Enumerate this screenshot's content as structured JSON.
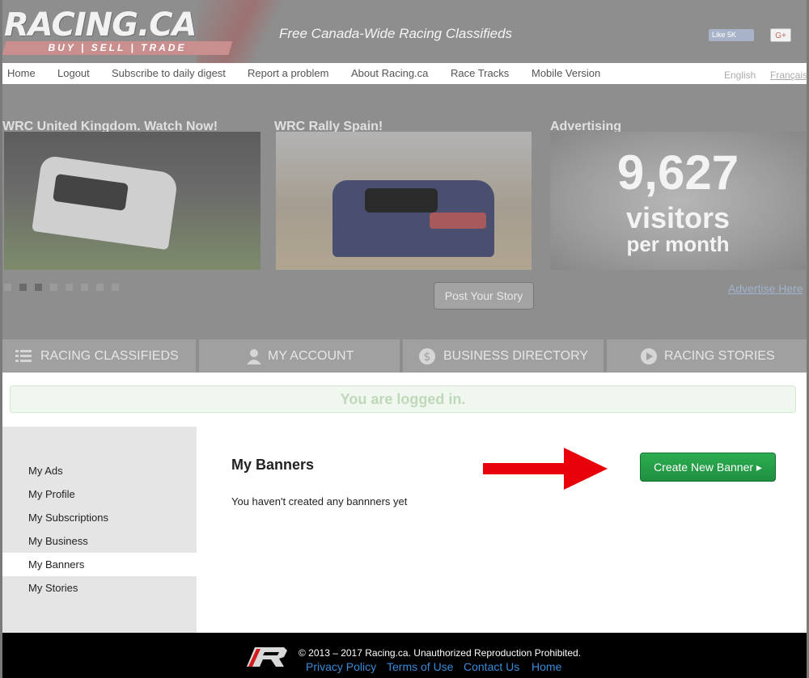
{
  "header": {
    "logo_word": "RACING.CA",
    "logo_tag": "BUY | SELL | TRADE",
    "tagline": "Free Canada-Wide Racing Classifieds",
    "fb_like": "Like 5K",
    "gplus": "G+"
  },
  "topnav": {
    "items": [
      "Home",
      "Logout",
      "Subscribe to daily digest",
      "Report a problem",
      "About Racing.ca",
      "Race Tracks",
      "Mobile Version"
    ],
    "lang_en": "English",
    "lang_fr": "Français"
  },
  "stories": {
    "story1_title": "WRC United Kingdom. Watch Now!",
    "story2_title": "WRC Rally Spain!",
    "ad_title": "Advertising",
    "ad_number": "9,627",
    "ad_visitors": "visitors",
    "ad_per_month": "per month",
    "post_button": "Post Your Story",
    "advertise_link": "Advertise Here",
    "slider_dots": 8,
    "slider_active": [
      1,
      2
    ]
  },
  "tabs": [
    "RACING CLASSIFIEDS",
    "MY ACCOUNT",
    "BUSINESS DIRECTORY",
    "RACING STORIES"
  ],
  "status": {
    "logged_in": "You are logged in."
  },
  "sidebar": {
    "items": [
      "My Ads",
      "My Profile",
      "My Subscriptions",
      "My Business",
      "My Banners",
      "My Stories"
    ],
    "active": "My Banners"
  },
  "main": {
    "title": "My Banners",
    "message": "You haven't created any bannners yet",
    "create_button": "Create New Banner ▸"
  },
  "footer": {
    "copyright": "© 2013 – 2017 Racing.ca. Unauthorized Reproduction Prohibited.",
    "links": [
      "Privacy Policy",
      "Terms of Use",
      "Contact Us",
      "Home"
    ]
  },
  "colors": {
    "accent_green": "#24a04a",
    "arrow_red": "#e8000b",
    "link_blue": "#3b8bd8"
  }
}
